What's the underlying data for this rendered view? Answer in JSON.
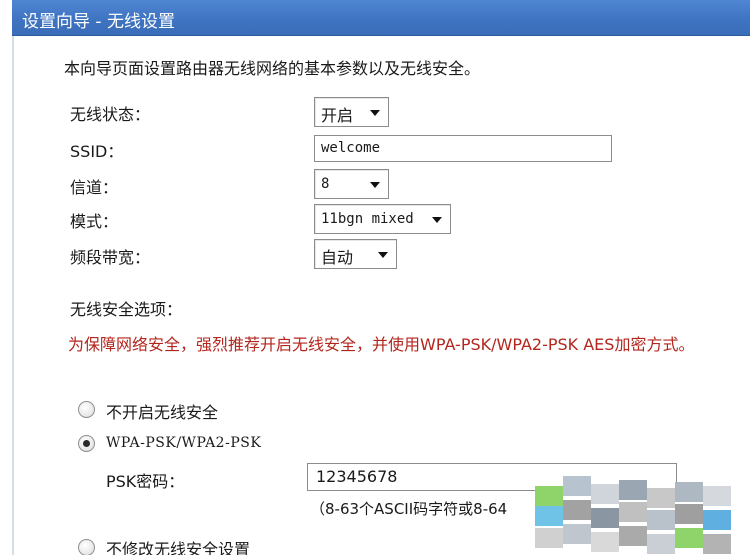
{
  "header": {
    "title": "设置向导 - 无线设置"
  },
  "intro": "本向导页面设置路由器无线网络的基本参数以及无线安全。",
  "fields": {
    "status": {
      "label": "无线状态：",
      "value": "开启"
    },
    "ssid": {
      "label": "SSID：",
      "value": "welcome"
    },
    "channel": {
      "label": "信道：",
      "value": "8"
    },
    "mode": {
      "label": "模式：",
      "value": "11bgn mixed"
    },
    "bandwidth": {
      "label": "频段带宽：",
      "value": "自动"
    }
  },
  "security": {
    "heading": "无线安全选项：",
    "warning": "为保障网络安全，强烈推荐开启无线安全，并使用WPA-PSK/WPA2-PSK AES加密方式。",
    "options": [
      "不开启无线安全",
      "WPA-PSK/WPA2-PSK",
      "不修改无线安全设置"
    ],
    "selected_index": 1,
    "psk_label": "PSK密码：",
    "psk_value": "12345678",
    "psk_hint": "（8-63个ASCII码字符或8-64"
  }
}
